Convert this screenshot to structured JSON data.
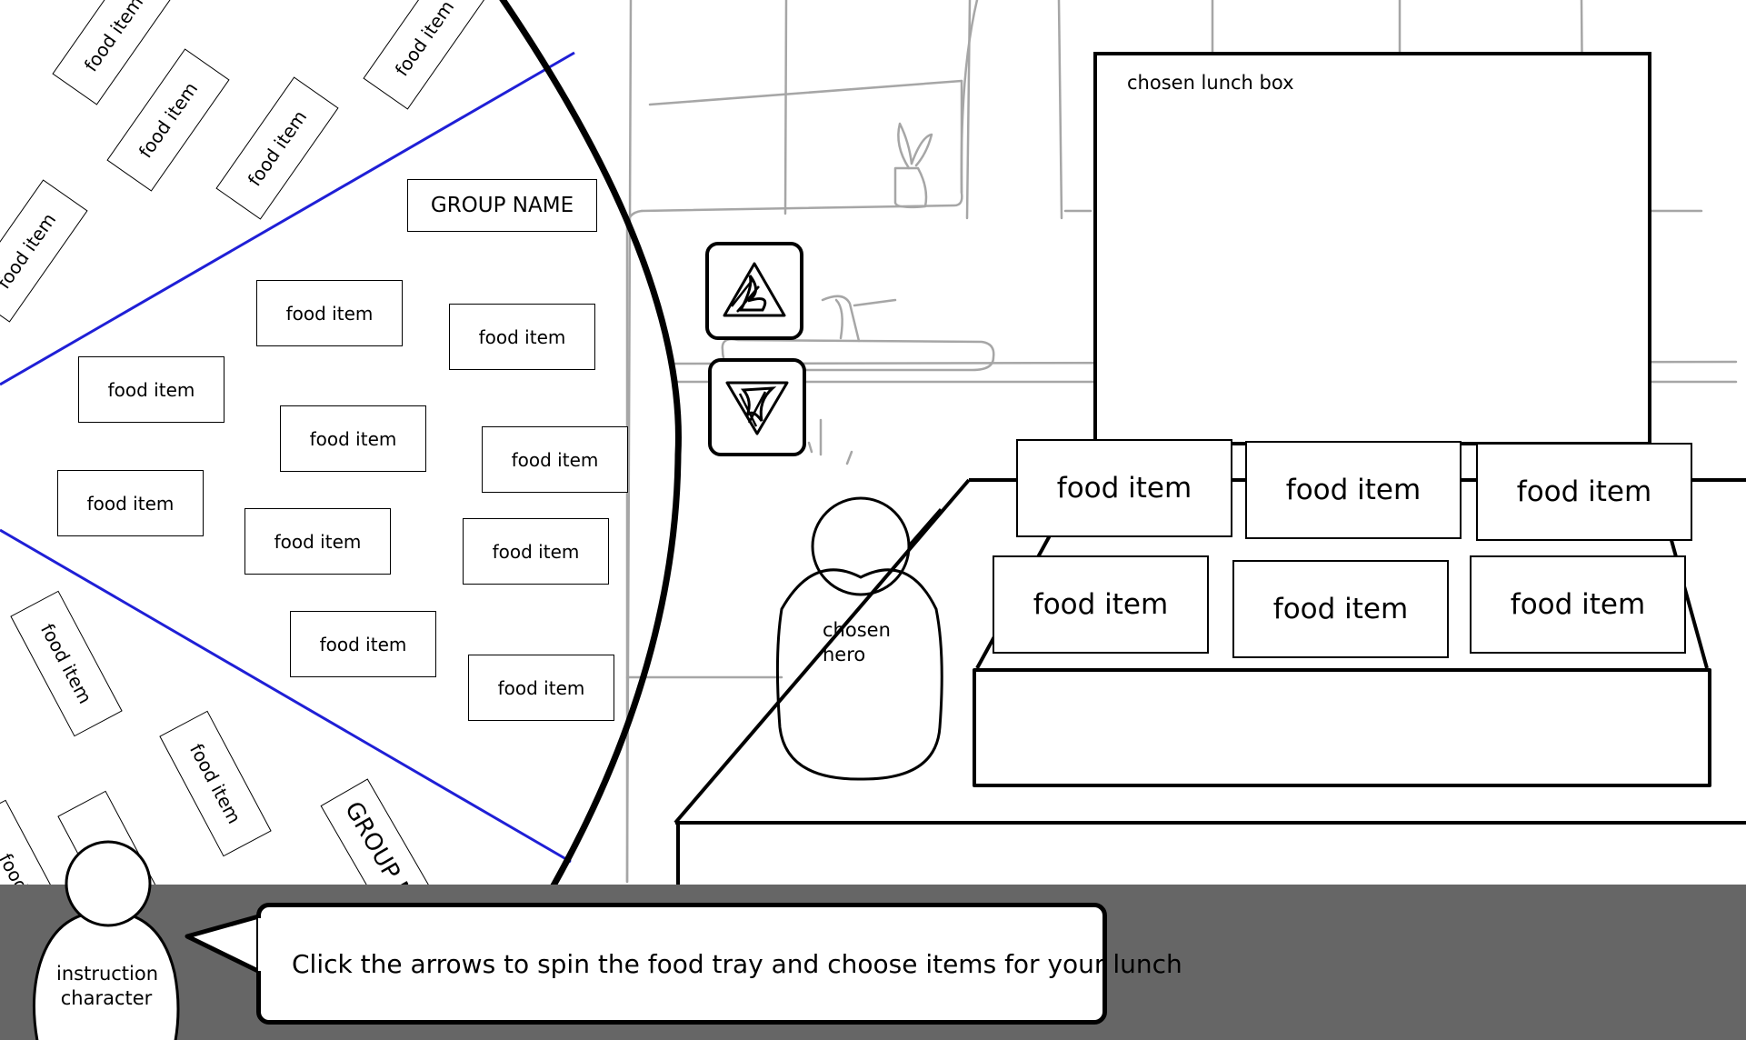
{
  "lunch_box": {
    "title": "chosen lunch box"
  },
  "wheel": {
    "group_name": "GROUP NAME",
    "group_name_lower": "GROUP N",
    "item_label": "food item",
    "items": [
      "food item",
      "food item",
      "food item",
      "food item",
      "food item",
      "food item",
      "food item",
      "food item",
      "food item",
      "food item"
    ],
    "upper_items": [
      "food item",
      "food item",
      "food item",
      "food item",
      "food item"
    ],
    "lower_items": [
      "food item",
      "food item",
      "fo",
      "food"
    ]
  },
  "lunch_box_items": {
    "top_row": [
      "food item",
      "food item",
      "food item"
    ],
    "bottom_row": [
      "food item",
      "food item",
      "food item"
    ]
  },
  "controls": {
    "spin_up": "up-arrow-icon",
    "spin_down": "down-arrow-icon"
  },
  "hero": {
    "label_line1": "chosen",
    "label_line2": "hero"
  },
  "instructor": {
    "label_line1": "instruction",
    "label_line2": "character"
  },
  "instruction_text": "Click the arrows to spin the food tray and choose items for your lunch",
  "colors": {
    "divider": "#1f1fd6",
    "bottom_bar": "#666666",
    "sketch": "#a6a6a6"
  }
}
